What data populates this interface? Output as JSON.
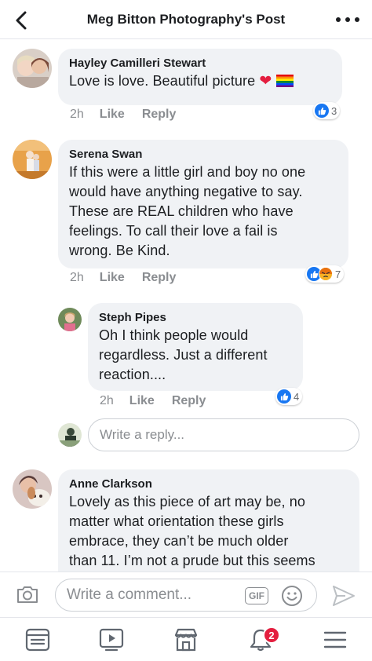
{
  "header": {
    "title": "Meg Bitton Photography's Post"
  },
  "comments": [
    {
      "author": "Hayley Camilleri Stewart",
      "text": "Love is love. Beautiful picture",
      "time": "2h",
      "like_label": "Like",
      "reply_label": "Reply",
      "reaction_count": "3"
    },
    {
      "author": "Serena Swan",
      "lines": [
        "If this were a little girl and boy no one",
        "would have anything negative to say.",
        "These are REAL children who have",
        "feelings. To call their love a fail is",
        "wrong. Be Kind."
      ],
      "time": "2h",
      "like_label": "Like",
      "reply_label": "Reply",
      "reaction_count": "7"
    },
    {
      "author": "Steph Pipes",
      "lines": [
        "Oh I think people would",
        "regardless. Just a different",
        "reaction...."
      ],
      "time": "2h",
      "like_label": "Like",
      "reply_label": "Reply",
      "reaction_count": "4"
    },
    {
      "author": "Anne Clarkson",
      "lines": [
        "Lovely as this piece of art may be, no",
        "matter what orientation these girls",
        "embrace, they can’t be much older",
        "than 11. I’m not a prude but this seems"
      ]
    }
  ],
  "reply_input": {
    "placeholder": "Write a reply..."
  },
  "composer": {
    "placeholder": "Write a comment...",
    "gif_label": "GIF"
  },
  "tabbar": {
    "notifications_badge": "2"
  },
  "colors": {
    "accent": "#1877f2",
    "bubble": "#f0f2f5",
    "muted": "#8a8d91",
    "badge": "#e41e3f"
  },
  "icons": [
    "back-arrow-icon",
    "more-dots-icon",
    "like-reaction-icon",
    "angry-reaction-icon",
    "heart-emoji-icon",
    "rainbow-flag-icon",
    "camera-icon",
    "smiley-icon",
    "send-icon",
    "news-feed-icon",
    "watch-icon",
    "marketplace-icon",
    "notifications-bell-icon",
    "menu-icon"
  ]
}
